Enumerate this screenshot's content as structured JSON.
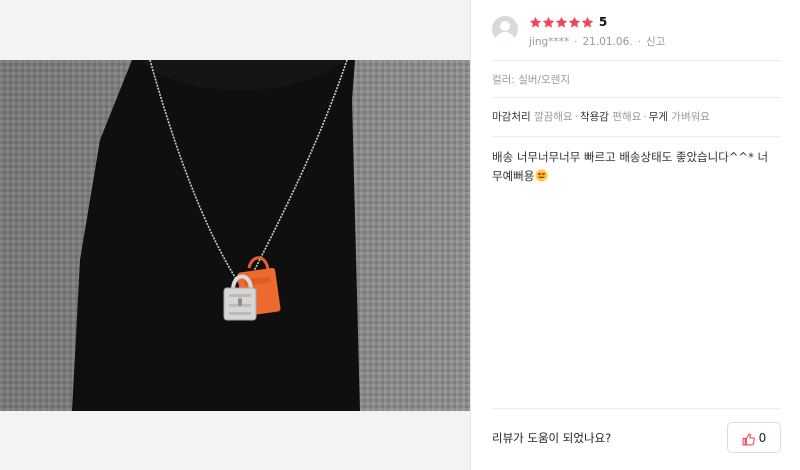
{
  "colors": {
    "star": "#f0465a",
    "accent_red": "#f0465a"
  },
  "review": {
    "rating": "5",
    "rating_value": 5,
    "username": "jing****",
    "date": "21.01.06.",
    "report_label": "신고",
    "option": "컬러: 실버/오렌지",
    "attributes": [
      {
        "name": "마감처리",
        "value": "깔끔해요"
      },
      {
        "name": "착용감",
        "value": "편해요"
      },
      {
        "name": "무게",
        "value": "가벼워요"
      }
    ],
    "content": "배송 너무너무너무 빠르고 배송상태도 좋았습니다^^* 너무예뻐용",
    "content_emoji": "heart-eyes-emoji"
  },
  "footer": {
    "helpful_question": "리뷰가 도움이 되었나요?",
    "like_count": "0"
  },
  "icons": {
    "avatar": "avatar-icon",
    "star": "star-icon",
    "like": "thumbs-up-icon"
  }
}
